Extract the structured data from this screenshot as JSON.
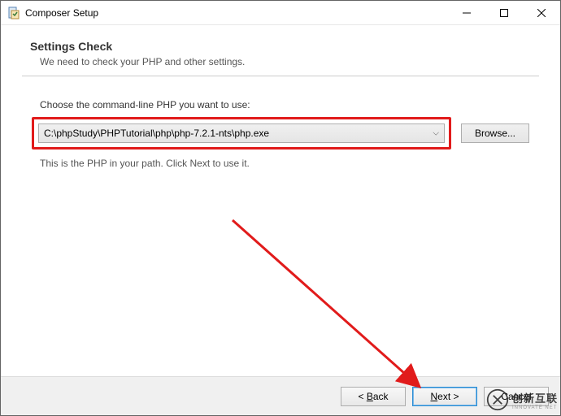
{
  "titlebar": {
    "title": "Composer Setup"
  },
  "header": {
    "heading": "Settings Check",
    "subheading": "We need to check your PHP and other settings."
  },
  "body": {
    "prompt": "Choose the command-line PHP you want to use:",
    "path_value": "C:\\phpStudy\\PHPTutorial\\php\\php-7.2.1-nts\\php.exe",
    "browse_label": "Browse...",
    "note": "This is the PHP in your path. Click Next to use it."
  },
  "footer": {
    "back": "< Back",
    "next_prefix": "N",
    "next_rest": "ext >",
    "cancel": "Cancel"
  },
  "watermark": {
    "text": "创新互联"
  }
}
